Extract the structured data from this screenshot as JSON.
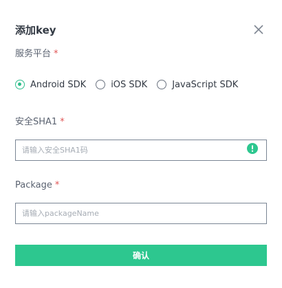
{
  "dialog": {
    "title": "添加key",
    "close_icon": "close-icon",
    "platform": {
      "label": "服务平台",
      "required_mark": "*",
      "options": [
        {
          "label": "Android SDK",
          "checked": true
        },
        {
          "label": "iOS SDK",
          "checked": false
        },
        {
          "label": "JavaScript SDK",
          "checked": false
        }
      ]
    },
    "sha1": {
      "label": "安全SHA1",
      "required_mark": "*",
      "placeholder": "请输入安全SHA1码",
      "value": "",
      "status_icon": "warning-icon"
    },
    "package": {
      "label": "Package",
      "required_mark": "*",
      "placeholder": "请输入packageName",
      "value": ""
    },
    "submit_label": "确认",
    "colors": {
      "accent": "#2dc78f",
      "required": "#e05555"
    }
  }
}
